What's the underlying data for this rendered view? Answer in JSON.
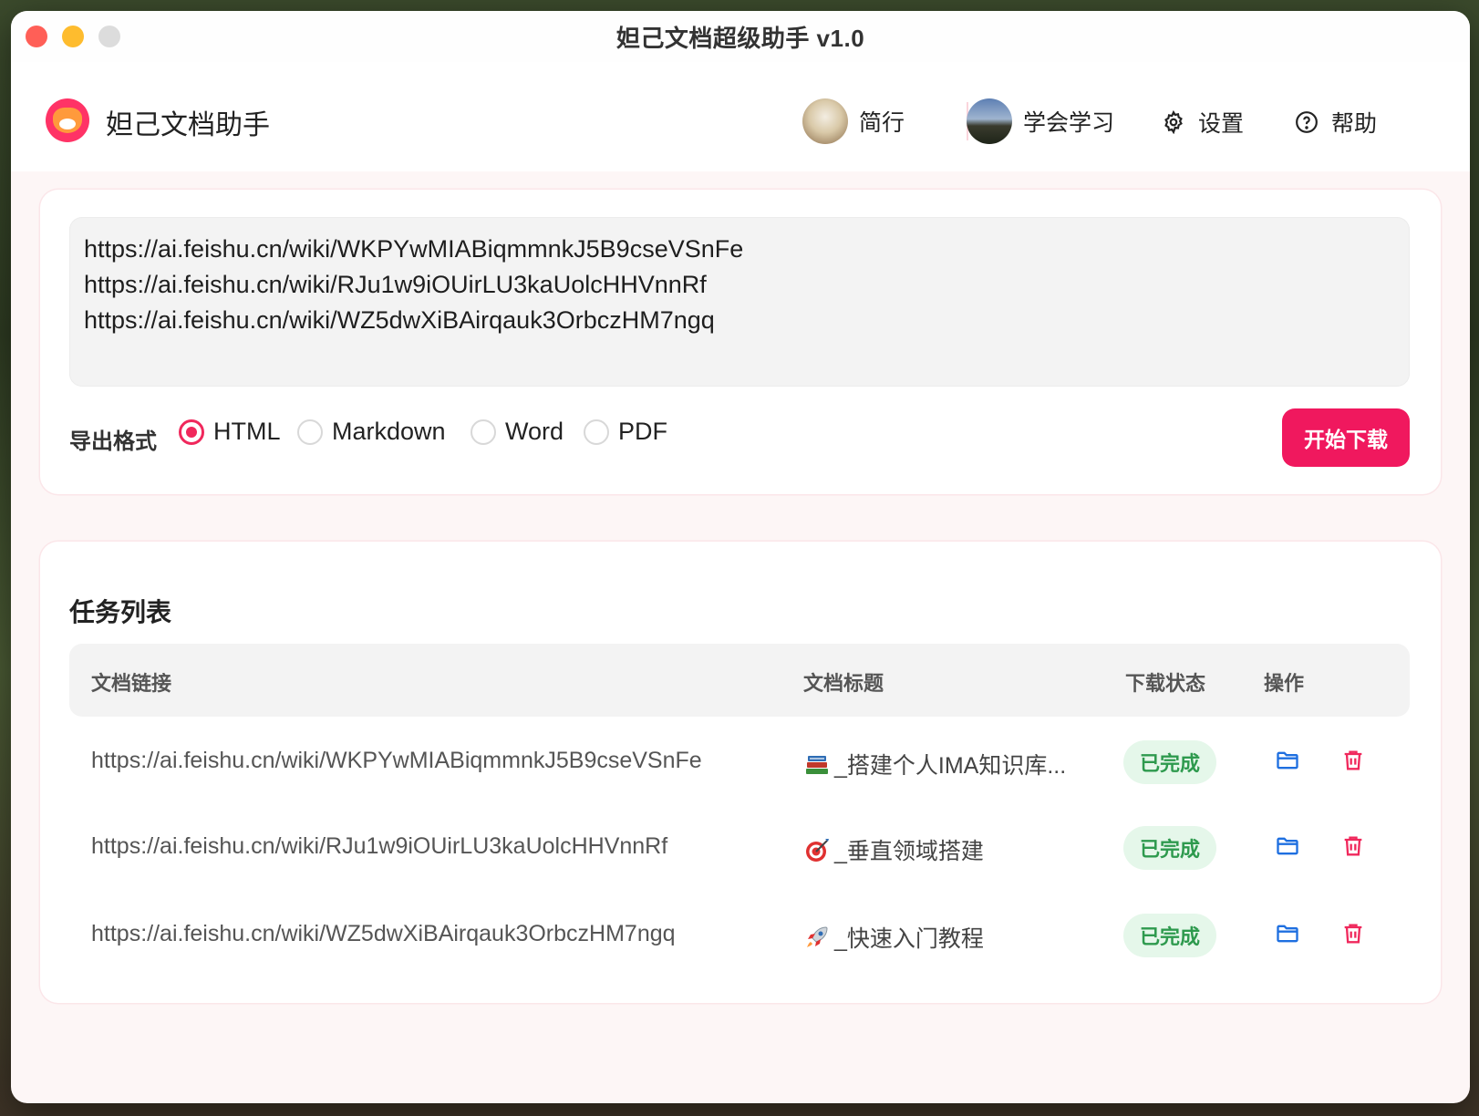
{
  "window": {
    "title": "妲己文档超级助手 v1.0"
  },
  "header": {
    "app_name": "妲己文档助手",
    "nav": {
      "user1": "简行",
      "user2": "学会学习",
      "settings": "设置",
      "help": "帮助"
    }
  },
  "input": {
    "urls": [
      "https://ai.feishu.cn/wiki/WKPYwMIABiqmmnkJ5B9cseVSnFe",
      "https://ai.feishu.cn/wiki/RJu1w9iOUirLU3kaUolcHHVnnRf",
      "https://ai.feishu.cn/wiki/WZ5dwXiBAirqauk3OrbczHM7ngq"
    ]
  },
  "export": {
    "label": "导出格式",
    "options": [
      "HTML",
      "Markdown",
      "Word",
      "PDF"
    ],
    "selected": "HTML",
    "start_label": "开始下载"
  },
  "tasks": {
    "title": "任务列表",
    "columns": [
      "文档链接",
      "文档标题",
      "下载状态",
      "操作"
    ],
    "rows": [
      {
        "url": "https://ai.feishu.cn/wiki/WKPYwMIABiqmmnkJ5B9cseVSnFe",
        "icon": "books-icon",
        "title": "_搭建个人IMA知识库...",
        "status": "已完成"
      },
      {
        "url": "https://ai.feishu.cn/wiki/RJu1w9iOUirLU3kaUolcHHVnnRf",
        "icon": "target-icon",
        "title": "_垂直领域搭建",
        "status": "已完成"
      },
      {
        "url": "https://ai.feishu.cn/wiki/WZ5dwXiBAirqauk3OrbczHM7ngq",
        "icon": "rocket-icon",
        "title": "_快速入门教程",
        "status": "已完成"
      }
    ]
  },
  "colors": {
    "accent": "#f0185e",
    "status_bg": "#e5f7ea",
    "status_text": "#2e9a4e",
    "folder_icon": "#1e6fe0",
    "trash_icon": "#f0285c"
  }
}
